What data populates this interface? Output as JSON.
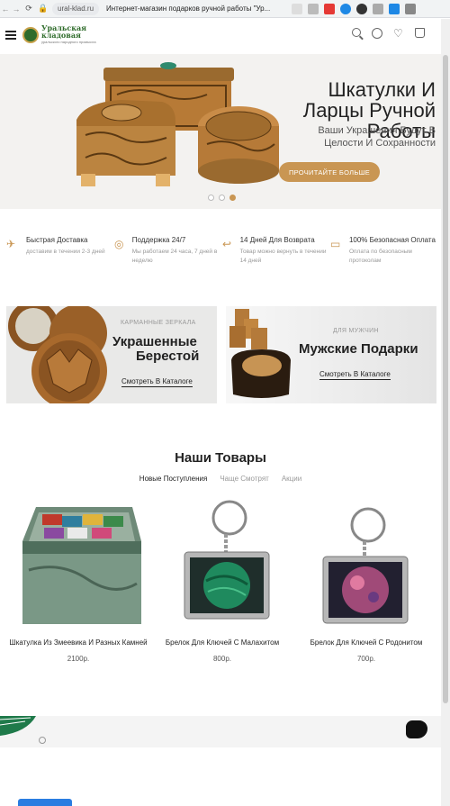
{
  "browser": {
    "url": "ural-klad.ru",
    "tab_title": "Интернет-магазин подарков ручной работы \"Ур..."
  },
  "header": {
    "logo_line1": "Уральская",
    "logo_line2": "кладовая",
    "logo_line3": "уральского народного промысла"
  },
  "hero": {
    "title": "Шкатулки И Ларцы Ручной Работы",
    "subtitle": "Ваши Украшения Будут В Целости И Сохранности",
    "button_label": "ПРОЧИТАЙТЕ БОЛЬШЕ",
    "slides": 3,
    "active_slide": 3,
    "accent_color": "#c99653"
  },
  "features": [
    {
      "icon": "plane-icon",
      "title": "Быстрая Доставка",
      "desc": "доставим в течении 2-3 дней"
    },
    {
      "icon": "support-icon",
      "title": "Поддержка 24/7",
      "desc": "Мы работаем 24 часа, 7 дней в неделю"
    },
    {
      "icon": "return-icon",
      "title": "14 Дней Для Возврата",
      "desc": "Товар можно вернуть в течении 14 дней"
    },
    {
      "icon": "card-icon",
      "title": "100% Безопасная Оплата",
      "desc": "Оплата по безопасным протоколам"
    }
  ],
  "banners": [
    {
      "kicker": "КАРМАННЫЕ ЗЕРКАЛА",
      "title_line1": "Украшенные",
      "title_line2": "Берестой",
      "link": "Смотреть В Каталоге"
    },
    {
      "kicker": "ДЛЯ МУЖЧИН",
      "title_line1": "Мужские Подарки",
      "link": "Смотреть В Каталоге"
    }
  ],
  "products_section": {
    "title": "Наши Товары",
    "tabs": [
      "Новые Поступления",
      "Чаще Смотрят",
      "Акции"
    ],
    "active_tab": "Новые Поступления"
  },
  "products": [
    {
      "name": "Шкатулка Из Змеевика И Разных Камней",
      "price": "2100р."
    },
    {
      "name": "Брелок Для Ключей С Малахитом",
      "price": "800р."
    },
    {
      "name": "Брелок Для Ключей С Родонитом",
      "price": "700р."
    }
  ]
}
